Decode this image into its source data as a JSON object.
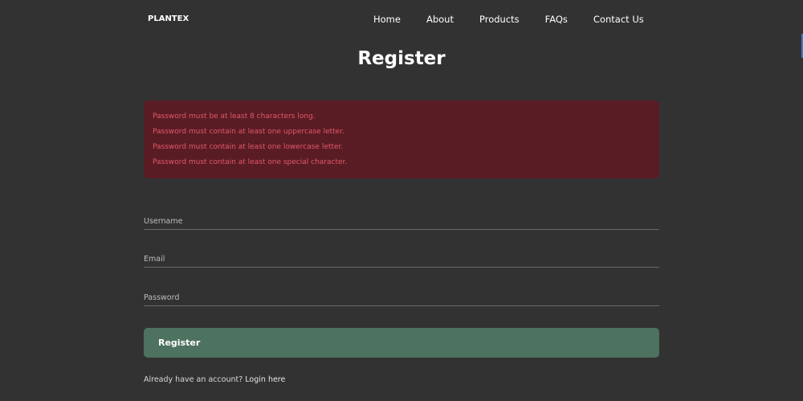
{
  "nav": {
    "logo": "PLANTEX",
    "links": [
      "Home",
      "About",
      "Products",
      "FAQs",
      "Contact Us"
    ]
  },
  "page_title": "Register",
  "errors": [
    "Password must be at least 8 characters long.",
    "Password must contain at least one uppercase letter.",
    "Password must contain at least one lowercase letter.",
    "Password must contain at least one special character."
  ],
  "form": {
    "username_placeholder": "Username",
    "email_placeholder": "Email",
    "password_placeholder": "Password",
    "submit_label": "Register"
  },
  "footer": {
    "prompt": "Already have an account?",
    "login_link": "Login here"
  },
  "colors": {
    "background": "#323232",
    "alert_bg": "#5a1c24",
    "alert_text": "#e2586a",
    "button": "#4e7260"
  }
}
